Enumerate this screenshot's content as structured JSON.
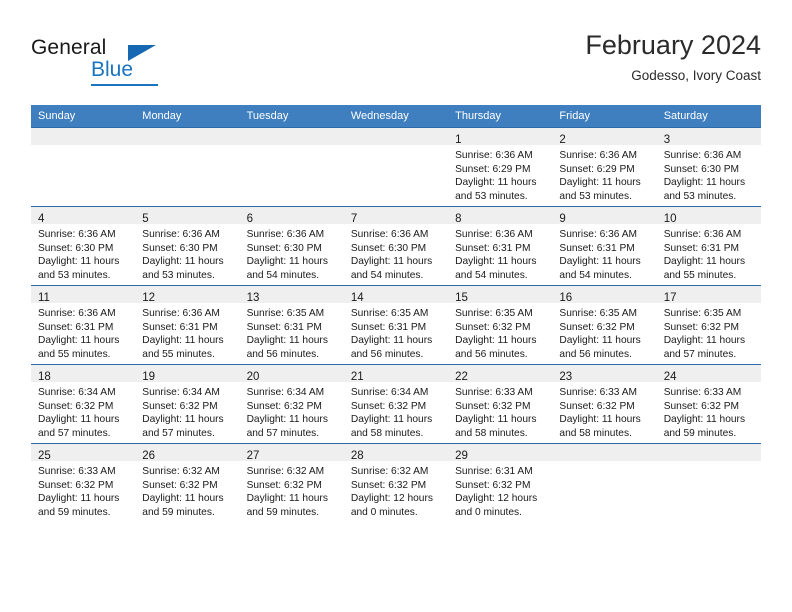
{
  "brand": {
    "name_part1": "General",
    "name_part2": "Blue",
    "accent_color": "#1a74c0",
    "triangle_color": "#1668b3"
  },
  "header": {
    "title": "February 2024",
    "location": "Godesso, Ivory Coast"
  },
  "calendar": {
    "header_bg": "#3f7fbf",
    "daynum_band_bg": "#efefef",
    "weekdays": [
      "Sunday",
      "Monday",
      "Tuesday",
      "Wednesday",
      "Thursday",
      "Friday",
      "Saturday"
    ],
    "weeks": [
      [
        {
          "day": "",
          "lines": []
        },
        {
          "day": "",
          "lines": []
        },
        {
          "day": "",
          "lines": []
        },
        {
          "day": "",
          "lines": []
        },
        {
          "day": "1",
          "lines": [
            "Sunrise: 6:36 AM",
            "Sunset: 6:29 PM",
            "Daylight: 11 hours",
            "and 53 minutes."
          ]
        },
        {
          "day": "2",
          "lines": [
            "Sunrise: 6:36 AM",
            "Sunset: 6:29 PM",
            "Daylight: 11 hours",
            "and 53 minutes."
          ]
        },
        {
          "day": "3",
          "lines": [
            "Sunrise: 6:36 AM",
            "Sunset: 6:30 PM",
            "Daylight: 11 hours",
            "and 53 minutes."
          ]
        }
      ],
      [
        {
          "day": "4",
          "lines": [
            "Sunrise: 6:36 AM",
            "Sunset: 6:30 PM",
            "Daylight: 11 hours",
            "and 53 minutes."
          ]
        },
        {
          "day": "5",
          "lines": [
            "Sunrise: 6:36 AM",
            "Sunset: 6:30 PM",
            "Daylight: 11 hours",
            "and 53 minutes."
          ]
        },
        {
          "day": "6",
          "lines": [
            "Sunrise: 6:36 AM",
            "Sunset: 6:30 PM",
            "Daylight: 11 hours",
            "and 54 minutes."
          ]
        },
        {
          "day": "7",
          "lines": [
            "Sunrise: 6:36 AM",
            "Sunset: 6:30 PM",
            "Daylight: 11 hours",
            "and 54 minutes."
          ]
        },
        {
          "day": "8",
          "lines": [
            "Sunrise: 6:36 AM",
            "Sunset: 6:31 PM",
            "Daylight: 11 hours",
            "and 54 minutes."
          ]
        },
        {
          "day": "9",
          "lines": [
            "Sunrise: 6:36 AM",
            "Sunset: 6:31 PM",
            "Daylight: 11 hours",
            "and 54 minutes."
          ]
        },
        {
          "day": "10",
          "lines": [
            "Sunrise: 6:36 AM",
            "Sunset: 6:31 PM",
            "Daylight: 11 hours",
            "and 55 minutes."
          ]
        }
      ],
      [
        {
          "day": "11",
          "lines": [
            "Sunrise: 6:36 AM",
            "Sunset: 6:31 PM",
            "Daylight: 11 hours",
            "and 55 minutes."
          ]
        },
        {
          "day": "12",
          "lines": [
            "Sunrise: 6:36 AM",
            "Sunset: 6:31 PM",
            "Daylight: 11 hours",
            "and 55 minutes."
          ]
        },
        {
          "day": "13",
          "lines": [
            "Sunrise: 6:35 AM",
            "Sunset: 6:31 PM",
            "Daylight: 11 hours",
            "and 56 minutes."
          ]
        },
        {
          "day": "14",
          "lines": [
            "Sunrise: 6:35 AM",
            "Sunset: 6:31 PM",
            "Daylight: 11 hours",
            "and 56 minutes."
          ]
        },
        {
          "day": "15",
          "lines": [
            "Sunrise: 6:35 AM",
            "Sunset: 6:32 PM",
            "Daylight: 11 hours",
            "and 56 minutes."
          ]
        },
        {
          "day": "16",
          "lines": [
            "Sunrise: 6:35 AM",
            "Sunset: 6:32 PM",
            "Daylight: 11 hours",
            "and 56 minutes."
          ]
        },
        {
          "day": "17",
          "lines": [
            "Sunrise: 6:35 AM",
            "Sunset: 6:32 PM",
            "Daylight: 11 hours",
            "and 57 minutes."
          ]
        }
      ],
      [
        {
          "day": "18",
          "lines": [
            "Sunrise: 6:34 AM",
            "Sunset: 6:32 PM",
            "Daylight: 11 hours",
            "and 57 minutes."
          ]
        },
        {
          "day": "19",
          "lines": [
            "Sunrise: 6:34 AM",
            "Sunset: 6:32 PM",
            "Daylight: 11 hours",
            "and 57 minutes."
          ]
        },
        {
          "day": "20",
          "lines": [
            "Sunrise: 6:34 AM",
            "Sunset: 6:32 PM",
            "Daylight: 11 hours",
            "and 57 minutes."
          ]
        },
        {
          "day": "21",
          "lines": [
            "Sunrise: 6:34 AM",
            "Sunset: 6:32 PM",
            "Daylight: 11 hours",
            "and 58 minutes."
          ]
        },
        {
          "day": "22",
          "lines": [
            "Sunrise: 6:33 AM",
            "Sunset: 6:32 PM",
            "Daylight: 11 hours",
            "and 58 minutes."
          ]
        },
        {
          "day": "23",
          "lines": [
            "Sunrise: 6:33 AM",
            "Sunset: 6:32 PM",
            "Daylight: 11 hours",
            "and 58 minutes."
          ]
        },
        {
          "day": "24",
          "lines": [
            "Sunrise: 6:33 AM",
            "Sunset: 6:32 PM",
            "Daylight: 11 hours",
            "and 59 minutes."
          ]
        }
      ],
      [
        {
          "day": "25",
          "lines": [
            "Sunrise: 6:33 AM",
            "Sunset: 6:32 PM",
            "Daylight: 11 hours",
            "and 59 minutes."
          ]
        },
        {
          "day": "26",
          "lines": [
            "Sunrise: 6:32 AM",
            "Sunset: 6:32 PM",
            "Daylight: 11 hours",
            "and 59 minutes."
          ]
        },
        {
          "day": "27",
          "lines": [
            "Sunrise: 6:32 AM",
            "Sunset: 6:32 PM",
            "Daylight: 11 hours",
            "and 59 minutes."
          ]
        },
        {
          "day": "28",
          "lines": [
            "Sunrise: 6:32 AM",
            "Sunset: 6:32 PM",
            "Daylight: 12 hours",
            "and 0 minutes."
          ]
        },
        {
          "day": "29",
          "lines": [
            "Sunrise: 6:31 AM",
            "Sunset: 6:32 PM",
            "Daylight: 12 hours",
            "and 0 minutes."
          ]
        },
        {
          "day": "",
          "lines": []
        },
        {
          "day": "",
          "lines": []
        }
      ]
    ]
  }
}
